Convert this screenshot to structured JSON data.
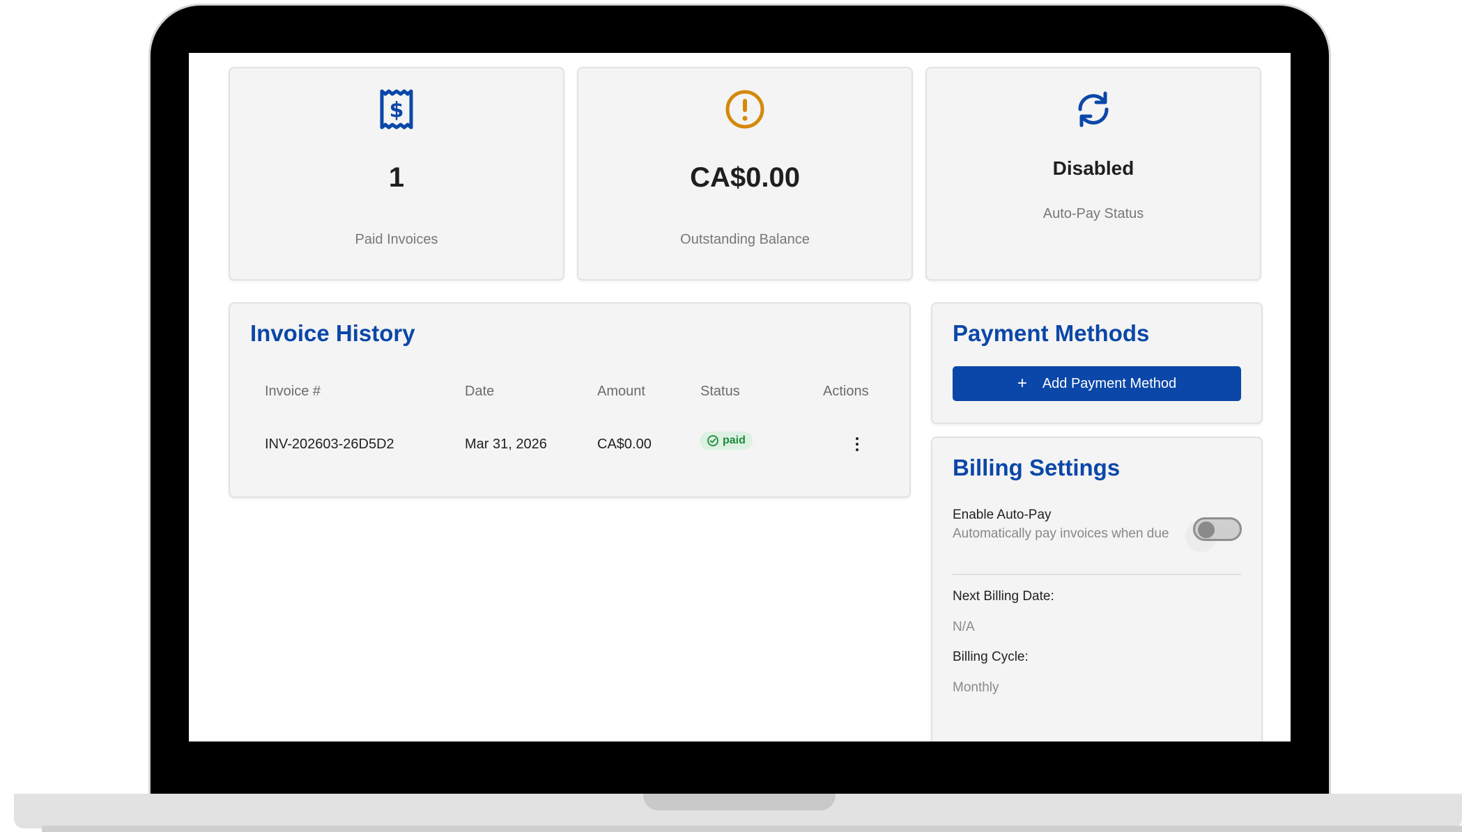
{
  "stats": [
    {
      "value": "1",
      "label": "Paid Invoices",
      "icon": "receipt-dollar-icon",
      "color": "#0b47a8"
    },
    {
      "value": "CA$0.00",
      "label": "Outstanding Balance",
      "icon": "alert-circle-icon",
      "color": "#d4890b"
    },
    {
      "value": "Disabled",
      "label": "Auto-Pay Status",
      "icon": "sync-icon",
      "color": "#0b47a8"
    }
  ],
  "invoice_history": {
    "title": "Invoice History",
    "columns": [
      "Invoice #",
      "Date",
      "Amount",
      "Status",
      "Actions"
    ],
    "rows": [
      {
        "invoice": "INV-202603-26D5D2",
        "date": "Mar 31, 2026",
        "amount": "CA$0.00",
        "status": "paid"
      }
    ]
  },
  "payment_methods": {
    "title": "Payment Methods",
    "add_label": "Add Payment Method"
  },
  "billing_settings": {
    "title": "Billing Settings",
    "autopay_label": "Enable Auto-Pay",
    "autopay_help": "Automatically pay invoices when due",
    "autopay_enabled": false,
    "next_billing_label": "Next Billing Date:",
    "next_billing_value": "N/A",
    "cycle_label": "Billing Cycle:",
    "cycle_value": "Monthly"
  },
  "colors": {
    "brand": "#0b47a8",
    "warning": "#d4890b",
    "success": "#1a8a3a",
    "success_bg": "#dcf1e2"
  }
}
